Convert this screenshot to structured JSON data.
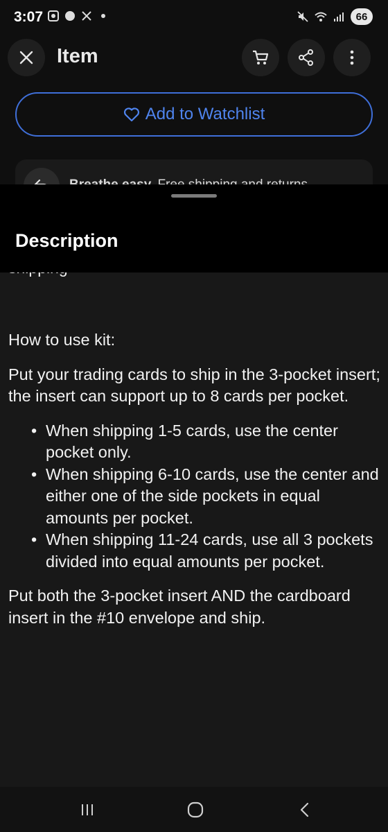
{
  "status_bar": {
    "time": "3:07",
    "battery": "66"
  },
  "header": {
    "title": "Item"
  },
  "watchlist": {
    "label": "Add to Watchlist"
  },
  "shipping_banner": {
    "bold": "Breathe easy.",
    "text": " Free shipping and returns."
  },
  "sheet": {
    "title": "Description"
  },
  "description": {
    "cutoff_line": "shipping",
    "heading": "How to use kit:",
    "intro": "Put your trading cards to ship in the 3-pocket insert; the insert can support up to 8 cards per pocket.",
    "bullets": [
      "When shipping 1-5 cards, use the center pocket only.",
      "When shipping 6-10 cards, use the center and either one of the side pockets in equal amounts per pocket.",
      "When shipping 11-24 cards, use all 3 pockets divided into equal amounts per pocket."
    ],
    "closing": "Put both the 3-pocket insert AND the cardboard insert in the #10 envelope and ship."
  },
  "icons": {
    "close": "close-icon",
    "cart": "cart-icon",
    "share": "share-icon",
    "more": "more-vertical-icon",
    "heart": "heart-outline-icon",
    "return": "return-arrow-icon",
    "recents": "recents-icon",
    "home": "home-icon",
    "back": "back-chevron-icon"
  },
  "colors": {
    "accent": "#4f84ee",
    "background": "#181818",
    "header": "#0f0f0f"
  }
}
